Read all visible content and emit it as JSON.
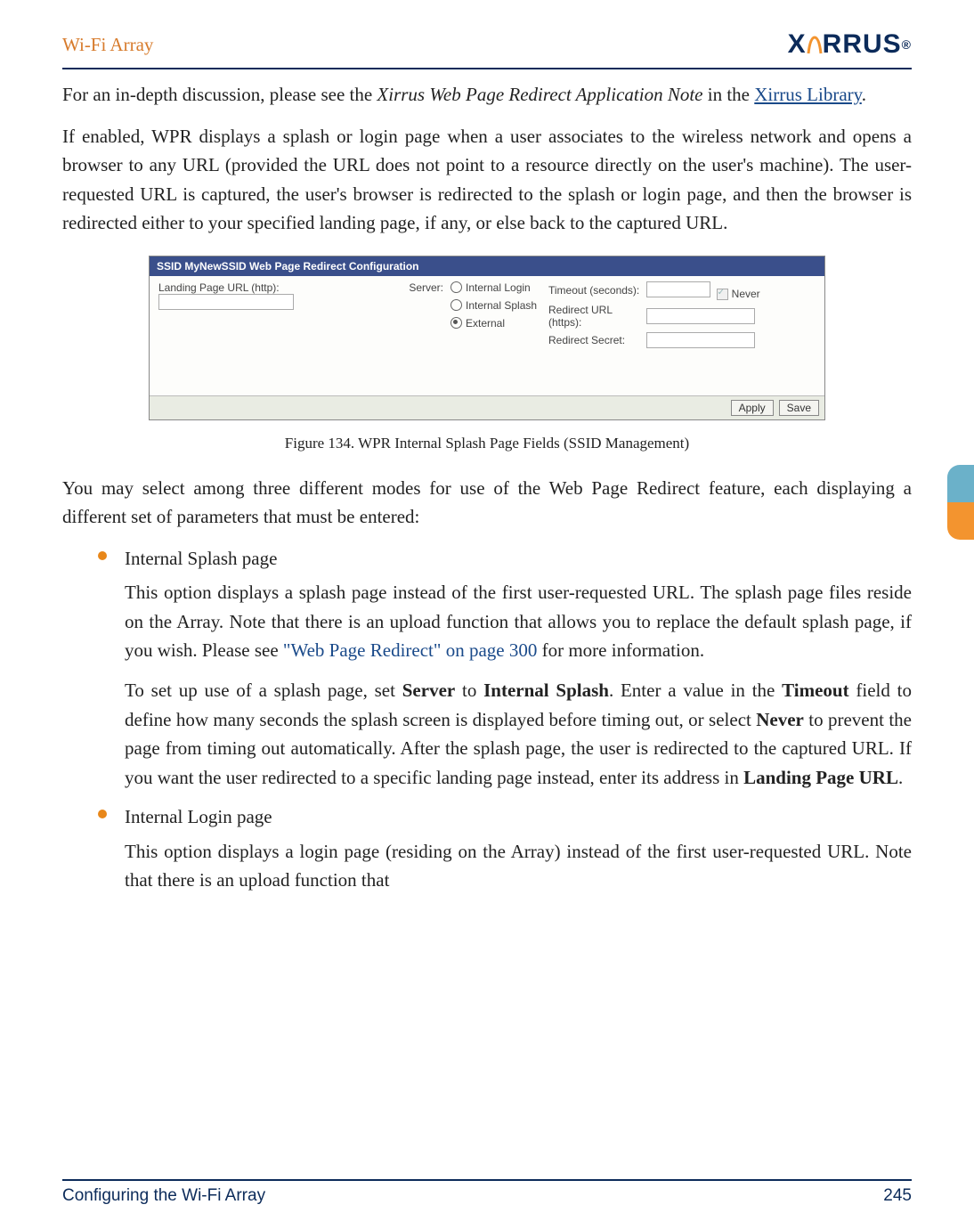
{
  "header": {
    "left": "Wi-Fi Array",
    "brand": "XIRRUS"
  },
  "intro": {
    "p1_a": "For an in-depth discussion, please see the ",
    "p1_i": "Xirrus Web Page Redirect Application Note",
    "p1_b": " in the ",
    "p1_link": "Xirrus Library",
    "p1_c": ".",
    "p2": "If enabled, WPR displays a splash or login page when a user associates to the wireless network and opens a browser to any URL (provided the URL does not point to a resource directly on the user's machine). The user-requested URL is captured, the user's browser is redirected to the splash or login page, and then the browser is redirected either to your specified landing page, if any, or else back to the captured URL."
  },
  "figure": {
    "titlebar": "SSID MyNewSSID  Web Page Redirect Configuration",
    "landing_label": "Landing Page URL (http):",
    "server_label": "Server:",
    "opt1": "Internal Login",
    "opt2": "Internal Splash",
    "opt3": "External",
    "timeout_label": "Timeout (seconds):",
    "never_label": "Never",
    "redirect_url_label": "Redirect URL (https):",
    "redirect_secret_label": "Redirect Secret:",
    "btn_apply": "Apply",
    "btn_save": "Save"
  },
  "caption": "Figure 134. WPR Internal Splash Page Fields (SSID Management)",
  "mid": {
    "p3": "You may select among three different modes for use of the Web Page Redirect feature, each displaying a different set of parameters that must be entered:"
  },
  "bullets": {
    "b1_title": "Internal Splash page",
    "b1_p1_a": "This option displays a splash page instead of the first user-requested URL. The splash page files reside on the Array. Note that there is an upload function that allows you to replace the default splash page, if you wish. Please see ",
    "b1_p1_link": "\"Web Page Redirect\" on page 300",
    "b1_p1_b": " for more information.",
    "b1_p2_a": "To set up use of a splash page, set ",
    "b1_p2_b1": "Server",
    "b1_p2_c": " to ",
    "b1_p2_b2": "Internal Splash",
    "b1_p2_d": ". Enter a value in the ",
    "b1_p2_b3": "Timeout",
    "b1_p2_e": " field to define how many seconds the splash screen is displayed before timing out, or select ",
    "b1_p2_b4": "Never",
    "b1_p2_f": " to prevent the page from timing out automatically. After the splash page, the user is redirected to the captured URL. If you want the user redirected to a specific landing page instead, enter its address in ",
    "b1_p2_b5": "Landing Page URL",
    "b1_p2_g": ".",
    "b2_title": "Internal Login page",
    "b2_p1": "This option displays a login page (residing on the Array) instead of the first user-requested URL. Note that there is an upload function that"
  },
  "footer": {
    "left": "Configuring the Wi-Fi Array",
    "right": "245"
  }
}
